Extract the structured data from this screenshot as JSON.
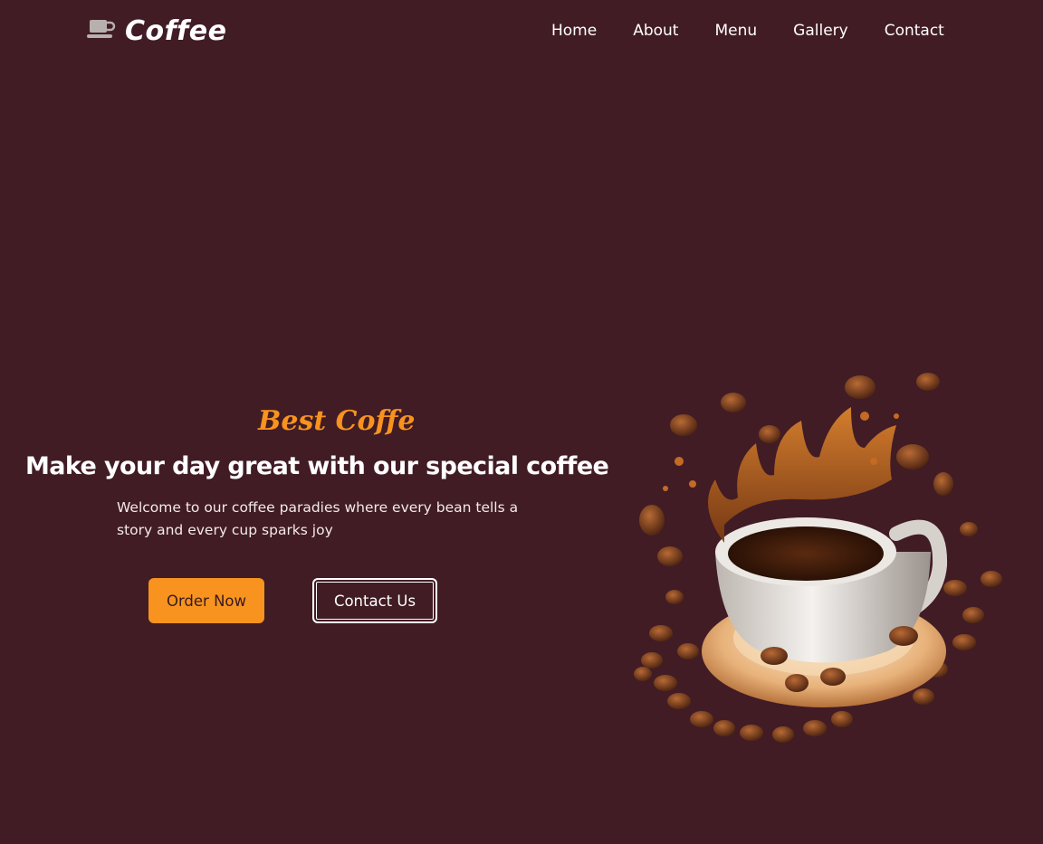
{
  "brand": {
    "name": "Coffee",
    "icon": "coffee-cup-icon"
  },
  "nav": {
    "items": [
      {
        "label": "Home"
      },
      {
        "label": "About"
      },
      {
        "label": "Menu"
      },
      {
        "label": "Gallery"
      },
      {
        "label": "Contact"
      }
    ]
  },
  "hero": {
    "subtitle": "Best Coffe",
    "headline": "Make your day great with our special coffee",
    "description": "Welcome to our coffee paradies where every bean tells a story and every cup sparks joy",
    "order_button": "Order Now",
    "contact_button": "Contact Us",
    "image": "coffee-splash-image"
  },
  "colors": {
    "background": "#411c25",
    "accent": "#f7931e",
    "text": "#ffffff"
  }
}
